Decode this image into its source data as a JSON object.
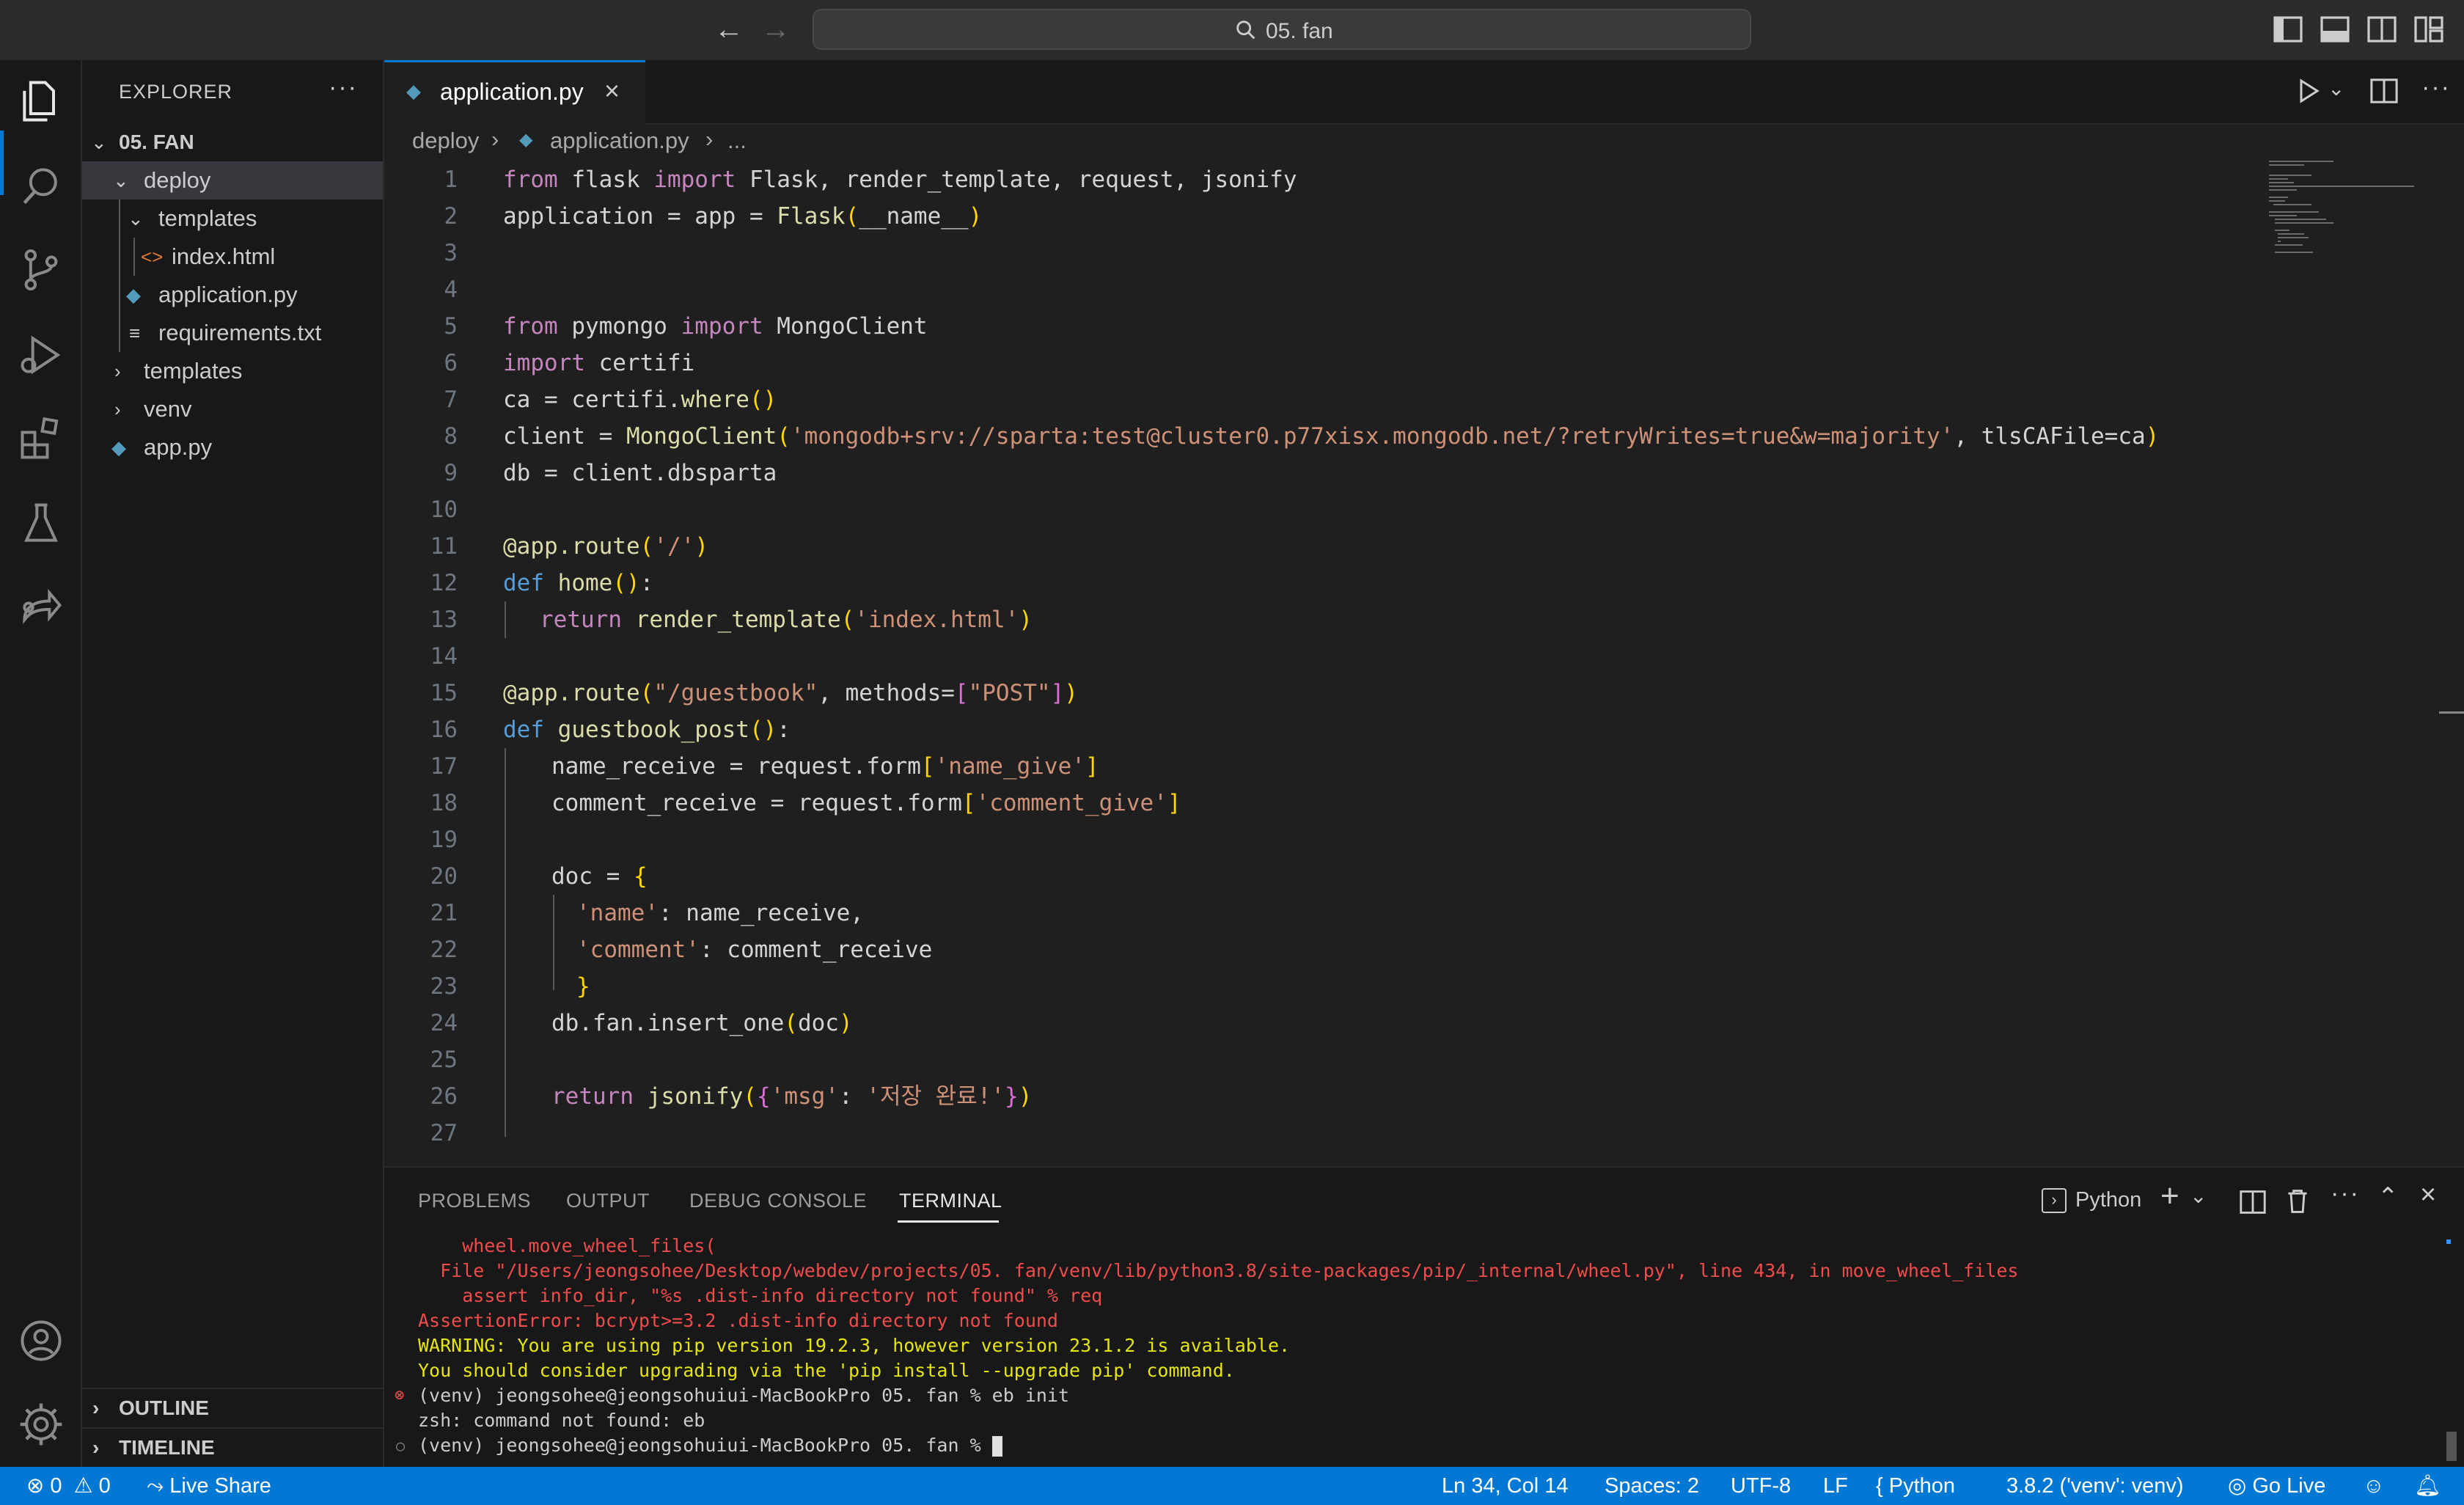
{
  "titlebar": {
    "search_text": "05. fan"
  },
  "explorer": {
    "title": "EXPLORER",
    "more": "···",
    "root": "05. FAN",
    "items": [
      {
        "label": "deploy",
        "type": "folder-open"
      },
      {
        "label": "templates",
        "type": "folder-open"
      },
      {
        "label": "index.html",
        "type": "html"
      },
      {
        "label": "application.py",
        "type": "python"
      },
      {
        "label": "requirements.txt",
        "type": "text"
      },
      {
        "label": "templates",
        "type": "folder"
      },
      {
        "label": "venv",
        "type": "folder"
      },
      {
        "label": "app.py",
        "type": "python"
      }
    ],
    "outline": "OUTLINE",
    "timeline": "TIMELINE"
  },
  "editor": {
    "tab_label": "application.py",
    "breadcrumb": {
      "folder": "deploy",
      "file": "application.py",
      "rest": "..."
    },
    "line_numbers": [
      "1",
      "2",
      "3",
      "4",
      "5",
      "6",
      "7",
      "8",
      "9",
      "10",
      "11",
      "12",
      "13",
      "14",
      "15",
      "16",
      "17",
      "18",
      "19",
      "20",
      "21",
      "22",
      "23",
      "24",
      "25",
      "26",
      "27"
    ]
  },
  "code": {
    "l1": {
      "a": "from",
      "b": " flask ",
      "c": "import",
      "d": " Flask, render_template, request, jsonify"
    },
    "l2": {
      "a": "application = app = ",
      "b": "Flask",
      "c": "(",
      "d": "__name__",
      "e": ")"
    },
    "l5": {
      "a": "from",
      "b": " pymongo ",
      "c": "import",
      "d": " MongoClient"
    },
    "l6": {
      "a": "import",
      "b": " certifi"
    },
    "l7": {
      "a": "ca = certifi.",
      "b": "where",
      "c": "()"
    },
    "l8": {
      "a": "client = ",
      "b": "MongoClient",
      "c": "(",
      "d": "'mongodb+srv://sparta:test@cluster0.p77xisx.mongodb.net/?retryWrites=true&w=majority'",
      "e": ", tlsCAFile=ca",
      "f": ")"
    },
    "l9": {
      "a": "db = client.dbsparta"
    },
    "l11": {
      "a": "@app.route",
      "b": "(",
      "c": "'/'",
      "d": ")"
    },
    "l12": {
      "a": "def",
      "b": " ",
      "c": "home",
      "d": "()",
      "e": ":"
    },
    "l13": {
      "a": "return",
      "b": " ",
      "c": "render_template",
      "d": "(",
      "e": "'index.html'",
      "f": ")"
    },
    "l15": {
      "a": "@app.route",
      "b": "(",
      "c": "\"/guestbook\"",
      "d": ", methods=",
      "e": "[",
      "f": "\"POST\"",
      "g": "]",
      "h": ")"
    },
    "l16": {
      "a": "def",
      "b": " ",
      "c": "guestbook_post",
      "d": "()",
      "e": ":"
    },
    "l17": {
      "a": "name_receive = request.form",
      "b": "[",
      "c": "'name_give'",
      "d": "]"
    },
    "l18": {
      "a": "comment_receive = request.form",
      "b": "[",
      "c": "'comment_give'",
      "d": "]"
    },
    "l20": {
      "a": "doc = ",
      "b": "{"
    },
    "l21": {
      "a": "'name'",
      "b": ": name_receive,"
    },
    "l22": {
      "a": "'comment'",
      "b": ": comment_receive"
    },
    "l23": {
      "a": "}"
    },
    "l24": {
      "a": "db.fan.insert_one",
      "b": "(",
      "c": "doc",
      "d": ")"
    },
    "l26": {
      "a": "return",
      "b": " ",
      "c": "jsonify",
      "d": "(",
      "e": "{",
      "f": "'msg'",
      "g": ": ",
      "h": "'저장 완료!'",
      "i": "}",
      "j": ")"
    }
  },
  "panel": {
    "tabs": [
      "PROBLEMS",
      "OUTPUT",
      "DEBUG CONSOLE",
      "TERMINAL"
    ],
    "active_tab": "TERMINAL",
    "terminal_name": "Python",
    "lines": [
      "    wheel.move_wheel_files(",
      "  File \"/Users/jeongsohee/Desktop/webdev/projects/05. fan/venv/lib/python3.8/site-packages/pip/_internal/wheel.py\", line 434, in move_wheel_files",
      "    assert info_dir, \"%s .dist-info directory not found\" % req",
      "AssertionError: bcrypt>=3.2 .dist-info directory not found",
      "WARNING: You are using pip version 19.2.3, however version 23.1.2 is available.",
      "You should consider upgrading via the 'pip install --upgrade pip' command.",
      "(venv) jeongsohee@jeongsohuiui-MacBookPro 05. fan % eb init",
      "zsh: command not found: eb",
      "(venv) jeongsohee@jeongsohuiui-MacBookPro 05. fan % "
    ]
  },
  "statusbar": {
    "errors": "0",
    "warnings": "0",
    "live_share": "Live Share",
    "cursor": "Ln 34, Col 14",
    "spaces": "Spaces: 2",
    "encoding": "UTF-8",
    "eol": "LF",
    "language": "Python",
    "interpreter": "3.8.2 ('venv': venv)",
    "go_live": "Go Live"
  },
  "colors": {
    "accent": "#0078d4",
    "error": "#f14c4c",
    "warning": "#e5e510"
  }
}
